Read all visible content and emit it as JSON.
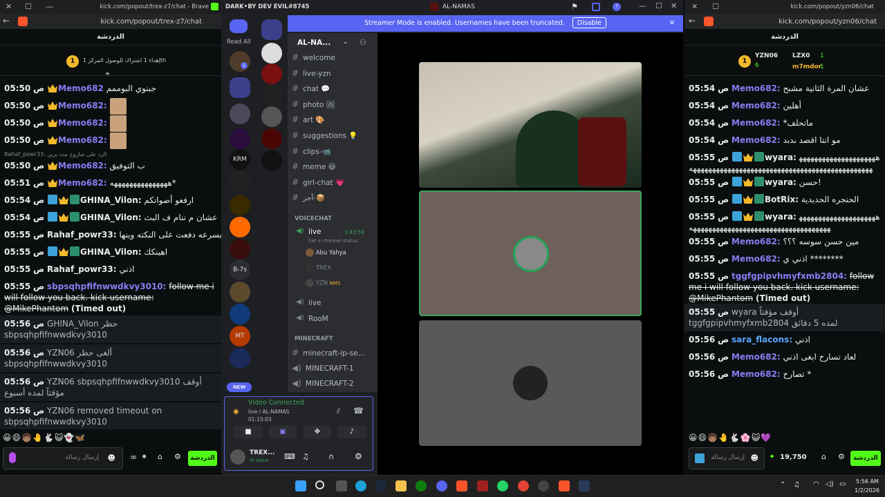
{
  "left_chat": {
    "title_url": "kick.com/popout/trex-z7/chat - Brave",
    "address": "kick.com/popout/trex-z7/chat",
    "header": "الدردشة",
    "pin_text": "إهداء 1 اشتراك للوصول المركز 1th",
    "goal_num": "1",
    "messages": [
      {
        "time": "05:50",
        "ampm": "ص",
        "user": "Memo682",
        "text": "جبنوي البوممم",
        "color": "#8a7cf2",
        "badges": [
          "c"
        ]
      },
      {
        "time": "05:50",
        "ampm": "ص",
        "user": "Memo682:",
        "img": true,
        "color": "#8a7cf2",
        "badges": [
          "c"
        ]
      },
      {
        "time": "05:50",
        "ampm": "ص",
        "user": "Memo682:",
        "img": true,
        "color": "#8a7cf2",
        "badges": [
          "c"
        ]
      },
      {
        "time": "05:50",
        "ampm": "ص",
        "user": "Memo682:",
        "img": true,
        "color": "#8a7cf2",
        "badges": [
          "c"
        ]
      },
      {
        "reply": "Rahaf_powr33: الرد على  شاروخ مث يرين"
      },
      {
        "time": "05:50",
        "ampm": "ص",
        "user": "Memo682:",
        "text": "ب التوفيق",
        "color": "#8a7cf2",
        "badges": [
          "c"
        ]
      },
      {
        "time": "05:51",
        "ampm": "ص",
        "user": "Memo682:",
        "text": "هههههههههههههههه*",
        "color": "#8a7cf2",
        "badges": [
          "c"
        ]
      },
      {
        "time": "05:54",
        "ampm": "ص",
        "user": "GHINA_Vilon:",
        "text": "ارفعو أصواتكم",
        "color": "#e9ebec",
        "badges": [
          "b",
          "c",
          "g"
        ]
      },
      {
        "time": "05:54",
        "ampm": "ص",
        "user": "GHINA_Vilon:",
        "text": "عشان م ننام ف البث",
        "color": "#e9ebec",
        "badges": [
          "b",
          "c",
          "g"
        ]
      },
      {
        "time": "05:55",
        "ampm": "ص",
        "user": "Rahaf_powr33:",
        "text": "عبدالله يلا بسرعه دفعت على النكته وينها",
        "color": "#e9ebec",
        "badges": []
      },
      {
        "time": "05:55",
        "ampm": "ص",
        "user": "GHINA_Vilon:",
        "text": "اهينكك",
        "color": "#e9ebec",
        "badges": [
          "b",
          "c",
          "g"
        ]
      },
      {
        "time": "05:55",
        "ampm": "ص",
        "user": "Rahaf_powr33:",
        "text": "اذني",
        "color": "#e9ebec",
        "badges": []
      },
      {
        "time": "05:55",
        "ampm": "ص",
        "user": "sbpsqhpfifnwwdkvy3010:",
        "text": "follow me i will follow you back. kick username: @MikePhantom",
        "suffix": "(Timed out)",
        "color": "#8a7cf2",
        "badges": []
      }
    ],
    "sys": [
      {
        "time": "05:56",
        "ampm": "ص",
        "text": "GHINA_Vilon حظر sbpsqhpfifnwwdkvy3010"
      },
      {
        "time": "05:56",
        "ampm": "ص",
        "text": "YZN06 ألغى حظر sbpsqhpfifnwwdkvy3010"
      },
      {
        "time": "05:56",
        "ampm": "ص",
        "text": "YZN06 sbpsqhpfifnwwdkvy3010 أوقف مؤقتاً لمده أسبوع"
      },
      {
        "time": "05:56",
        "ampm": "ص",
        "text": "YZN06 removed timeout on sbpsqhpfifnwwdkvy3010"
      }
    ],
    "emotes": "😀😄🧒🏽🤚🐇😺👻🦋",
    "input_placeholder": "إرسال رسالة",
    "send_label": "الدردشة"
  },
  "discord": {
    "title": "DARK•BY DEV EVIL#8745",
    "window": "AL-NAMAS",
    "read_all": "Read All",
    "banner": "Streamer Mode is enabled. Usernames have been truncated.",
    "disable": "Disable",
    "server": "AL-NA...",
    "channels": [
      "welcome",
      "live-yzn",
      "chat 💬",
      "photo 🖼",
      "art 🎨",
      "suggestions 💡",
      "clips-📹",
      "meme 😃",
      "girl-chat 💗",
      "آجر-📦"
    ],
    "voicechat": "VOICECHAT",
    "live": "live",
    "live_time": "1:43:59",
    "set_status": "Set a channel status",
    "members": [
      "Abu Yahya",
      "TREX",
      "YZN"
    ],
    "nms": "NMS",
    "live2": "live",
    "room": "RooM",
    "minecraft": "MINECRAFT",
    "mc": [
      "minecraft-ip-se...",
      "MINECRAFT-1",
      "MINECRAFT-2"
    ],
    "new": "NEW",
    "vc_connected": "Video Connected",
    "vc_where": "live / AL-NAMAS",
    "vc_time": "01:15:03",
    "user": "TREX...",
    "user_status": "In voice",
    "guild_labels": [
      "KRM",
      "B-7s",
      "MT"
    ]
  },
  "right_chat": {
    "address": "kick.com/popout/yzn06/chat",
    "header": "الدردشة",
    "top": [
      {
        "name": "YZN06",
        "n": "6"
      },
      {
        "name": "LZX0",
        "n": "1"
      },
      {
        "name": "m7mdor",
        "n": "1"
      }
    ],
    "goal_num": "1",
    "messages": [
      {
        "time": "05:54",
        "ampm": "ص",
        "user": "Memo682:",
        "text": "عشان المرة الثانية مشبح",
        "color": "#8a7cf2"
      },
      {
        "time": "05:54",
        "ampm": "ص",
        "user": "Memo682:",
        "text": "أهلين",
        "color": "#8a7cf2"
      },
      {
        "time": "05:54",
        "ampm": "ص",
        "user": "Memo682:",
        "text": "*ماتحلف",
        "color": "#8a7cf2"
      },
      {
        "time": "05:54",
        "ampm": "ص",
        "user": "Memo682:",
        "text": "مو انتا اقصد بدبد",
        "color": "#8a7cf2"
      },
      {
        "time": "05:55",
        "ampm": "ص",
        "user": "wyara:",
        "text": "ههههههههههههههههههههههههههههههههههههههههههههههههههههههههههههههههههههه",
        "color": "#e9ebec",
        "multi": true
      },
      {
        "time": "05:55",
        "ampm": "ص",
        "user": "wyara:",
        "text": "حسن!",
        "color": "#e9ebec"
      },
      {
        "time": "05:55",
        "ampm": "ص",
        "user": "BotRix:",
        "text": "الحنجره الحديدية",
        "color": "#e9ebec"
      },
      {
        "time": "05:55",
        "ampm": "ص",
        "user": "wyara:",
        "text": "هههههههههههههههههههههههههههههههههههههههههههههههههههههههههه",
        "color": "#e9ebec",
        "multi": true
      },
      {
        "time": "05:55",
        "ampm": "ص",
        "user": "Memo682:",
        "text": "مين حسن سوسه ؟؟؟",
        "color": "#8a7cf2"
      },
      {
        "time": "05:55",
        "ampm": "ص",
        "user": "Memo682:",
        "text": "اذني ي ********",
        "color": "#8a7cf2"
      },
      {
        "time": "05:55",
        "ampm": "ص",
        "user": "tggfgpipvhmyfxmb2804:",
        "text": "follow me i will follow you back. kick username: @MikePhantom",
        "suffix": "(Timed out)",
        "color": "#8a7cf2"
      }
    ],
    "sys": {
      "time": "05:55",
      "ampm": "ص",
      "text": "wyara أوقف مؤقتاً tggfgpipvhmyfxmb2804 لمده 5 دقائق"
    },
    "after": [
      {
        "time": "05:56",
        "ampm": "ص",
        "user": "sara_flacons:",
        "text": "اذني",
        "color": "#58a6ff"
      },
      {
        "time": "05:56",
        "ampm": "ص",
        "user": "Memo682:",
        "text": "لعاد تسارخ ابغى اذني",
        "color": "#8a7cf2"
      },
      {
        "time": "05:56",
        "ampm": "ص",
        "user": "Memo682:",
        "text": "تصارخ *",
        "color": "#8a7cf2"
      }
    ],
    "emotes": "😀😄🧒🏽🤚🐇🌸😺💜",
    "input_placeholder": "إرسال رسالة",
    "points": "19,750",
    "send_label": "الدردشة"
  },
  "taskbar": {
    "time": "5:56 AM",
    "date": "1/2/2026"
  }
}
